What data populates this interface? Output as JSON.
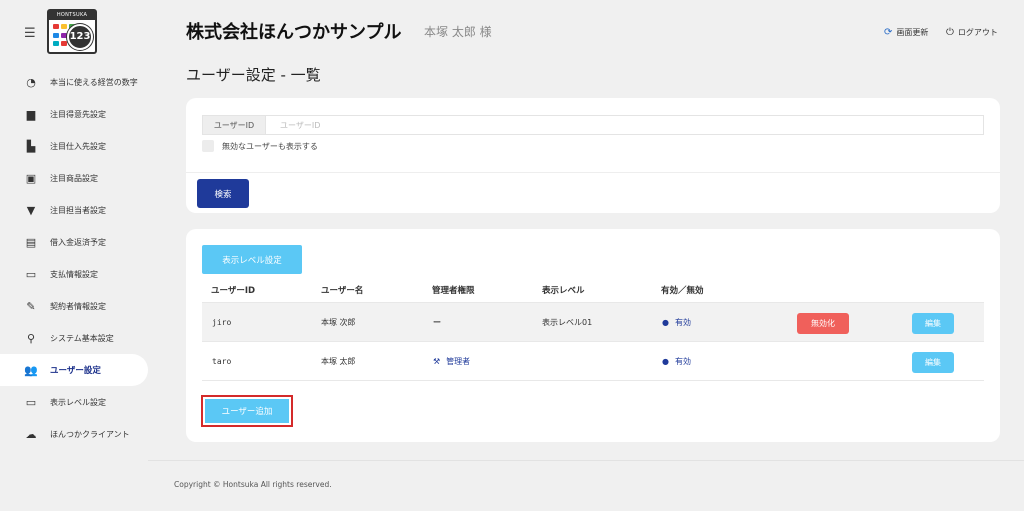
{
  "logo": {
    "brand": "HONTSUKA",
    "number": "123"
  },
  "sidebar": {
    "items": [
      {
        "label": "本当に使える経営の数字",
        "icon": "speedometer-icon",
        "glyph": "◔",
        "active": false
      },
      {
        "label": "注目得意先設定",
        "icon": "briefcase-icon",
        "glyph": "▆",
        "active": false
      },
      {
        "label": "注目仕入先設定",
        "icon": "warehouse-icon",
        "glyph": "▙",
        "active": false
      },
      {
        "label": "注目商品設定",
        "icon": "clipboard-check-icon",
        "glyph": "▣",
        "active": false
      },
      {
        "label": "注目担当者設定",
        "icon": "necktie-icon",
        "glyph": "▼",
        "active": false
      },
      {
        "label": "借入金返済予定",
        "icon": "money-icon",
        "glyph": "▤",
        "active": false
      },
      {
        "label": "支払情報設定",
        "icon": "credit-card-icon",
        "glyph": "▭",
        "active": false
      },
      {
        "label": "契約者情報設定",
        "icon": "pen-icon",
        "glyph": "✎",
        "active": false
      },
      {
        "label": "システム基本設定",
        "icon": "wrench-icon",
        "glyph": "⚲",
        "active": false
      },
      {
        "label": "ユーザー設定",
        "icon": "users-icon",
        "glyph": "👥",
        "active": true
      },
      {
        "label": "表示レベル設定",
        "icon": "laptop-icon",
        "glyph": "▭",
        "active": false
      },
      {
        "label": "ほんつかクライアント",
        "icon": "cloud-download-icon",
        "glyph": "☁",
        "active": false
      }
    ]
  },
  "header": {
    "company": "株式会社ほんつかサンプル",
    "user": "本塚 太郎 様",
    "refresh": "画面更新",
    "logout": "ログアウト"
  },
  "page": {
    "title": "ユーザー設定 - 一覧"
  },
  "search": {
    "label": "ユーザーID",
    "placeholder": "ユーザーID",
    "show_inactive": "無効なユーザーも表示する",
    "button": "検索"
  },
  "table": {
    "level_button": "表示レベル設定",
    "headers": [
      "ユーザーID",
      "ユーザー名",
      "管理者権限",
      "表示レベル",
      "有効／無効"
    ],
    "rows": [
      {
        "id": "jiro",
        "name": "本塚 次郎",
        "admin": "ー",
        "level": "表示レベル01",
        "status": "有効",
        "disable": "無効化",
        "edit": "編集"
      },
      {
        "id": "taro",
        "name": "本塚 太郎",
        "admin": "管理者",
        "level": "",
        "status": "有効",
        "disable": "",
        "edit": "編集"
      }
    ],
    "add_button": "ユーザー追加"
  },
  "footer": {
    "copyright": "Copyright © Hontsuka All rights reserved."
  },
  "colors": {
    "primary": "#1f3a9a",
    "accent": "#5bc8f5",
    "danger": "#f0605b",
    "highlight": "#d42a2a"
  }
}
